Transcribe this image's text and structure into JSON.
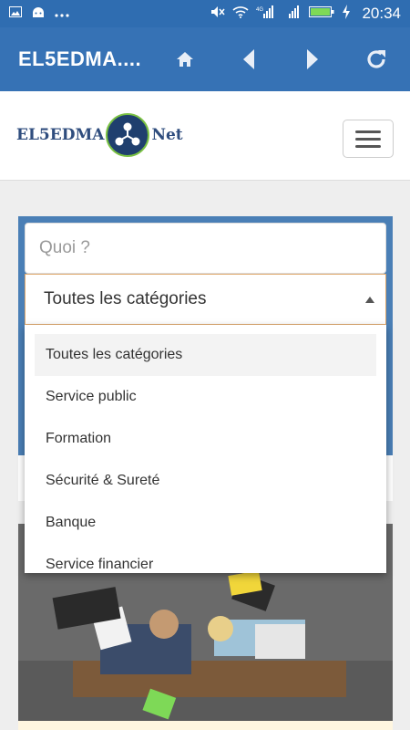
{
  "status_bar": {
    "time": "20:34",
    "network_label": "4G",
    "icons": [
      "image-icon",
      "android-icon",
      "more-icon",
      "mute-icon",
      "wifi-icon",
      "signal-icon",
      "signal-icon",
      "battery-icon",
      "charging-icon"
    ]
  },
  "app_bar": {
    "title": "EL5EDMA....",
    "icons": [
      "home-icon",
      "back-icon",
      "forward-icon",
      "refresh-icon"
    ]
  },
  "site": {
    "logo_left": "EL5EDMA",
    "logo_right": "Net"
  },
  "search": {
    "placeholder": "Quoi ?",
    "selected_category": "Toutes les catégories"
  },
  "dropdown": {
    "options": [
      "Toutes les catégories",
      "Service public",
      "Formation",
      "Sécurité & Sureté",
      "Banque",
      "Service financier"
    ]
  },
  "colors": {
    "status_bar": "#2f6db1",
    "app_bar": "#3672b5",
    "panel": "#4a7fb6",
    "select_border": "#e0a96d"
  }
}
